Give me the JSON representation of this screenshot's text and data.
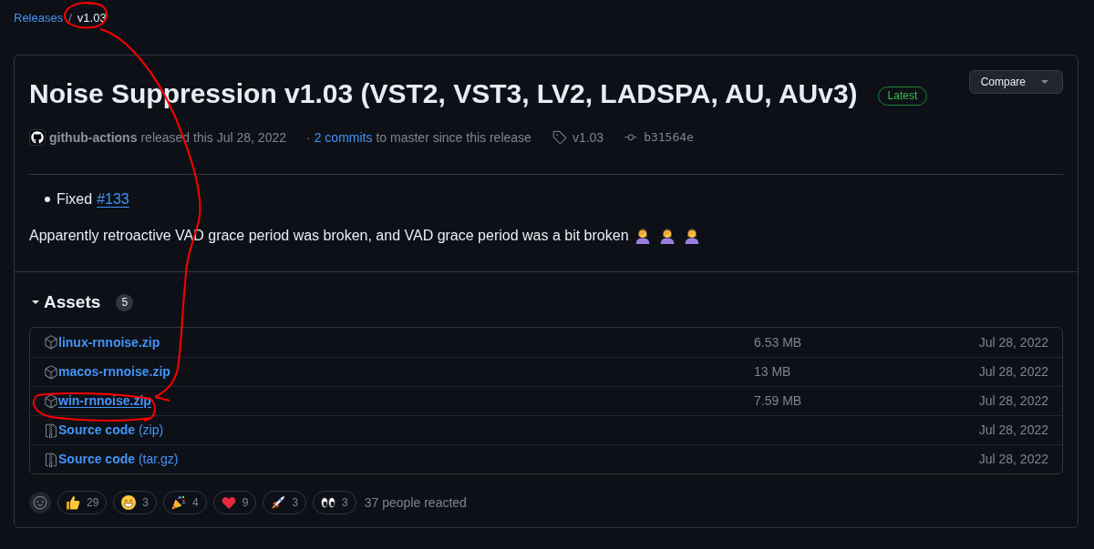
{
  "breadcrumb": {
    "link": "Releases",
    "separator": "/",
    "current": "v1.03"
  },
  "release": {
    "title": "Noise Suppression v1.03 (VST2, VST3, LV2, LADSPA, AU, AUv3)",
    "badge": "Latest",
    "compare_button": "Compare",
    "author": "github-actions",
    "released_text": "released this Jul 28, 2022",
    "commits_separator": "·",
    "commits_link": "2 commits",
    "commits_text": "to master since this release",
    "tag": "v1.03",
    "commit": "b31564e"
  },
  "notes": {
    "bullets": [
      {
        "text": "Fixed",
        "link": "#133"
      }
    ],
    "paragraph": "Apparently retroactive VAD grace period was broken, and VAD grace period was a bit broken"
  },
  "assets": {
    "title": "Assets",
    "count": "5",
    "expanded": true,
    "items": [
      {
        "kind": "package",
        "name": "linux-rnnoise.zip",
        "size": "6.53 MB",
        "date": "Jul 28, 2022",
        "hovered": false
      },
      {
        "kind": "package",
        "name": "macos-rnnoise.zip",
        "size": "13 MB",
        "date": "Jul 28, 2022",
        "hovered": false
      },
      {
        "kind": "package",
        "name": "win-rnnoise.zip",
        "size": "7.59 MB",
        "date": "Jul 28, 2022",
        "hovered": true
      },
      {
        "kind": "source",
        "name": "Source code",
        "suffix": "(zip)",
        "date": "Jul 28, 2022",
        "hovered": false
      },
      {
        "kind": "source",
        "name": "Source code",
        "suffix": "(tar.gz)",
        "date": "Jul 28, 2022",
        "hovered": false
      }
    ]
  },
  "reactions": {
    "items": [
      {
        "kind": "thumbs-up",
        "count": "29"
      },
      {
        "kind": "grin",
        "count": "3"
      },
      {
        "kind": "party",
        "count": "4"
      },
      {
        "kind": "heart",
        "count": "9"
      },
      {
        "kind": "rocket",
        "count": "3"
      },
      {
        "kind": "eyes",
        "count": "3"
      }
    ],
    "summary": "37 people reacted"
  }
}
